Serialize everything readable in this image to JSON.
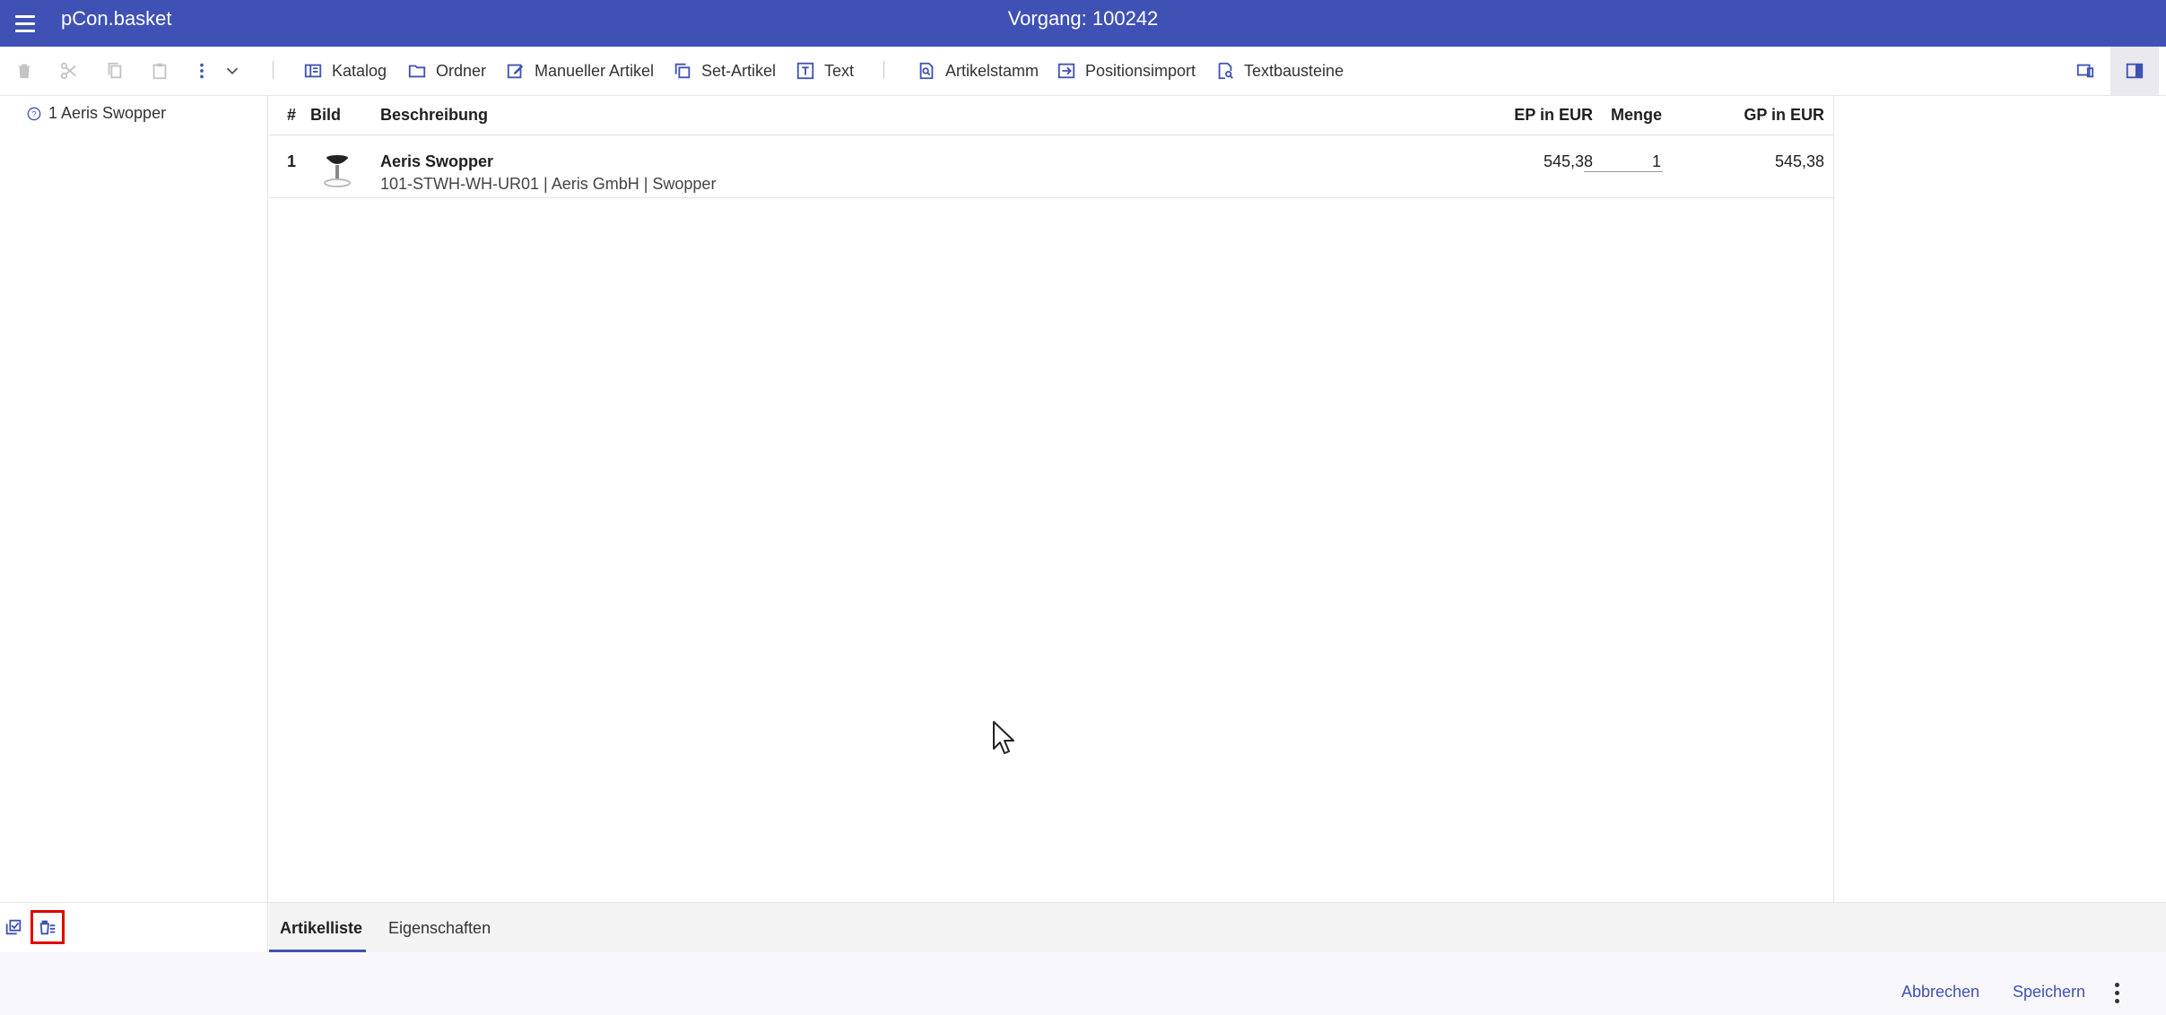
{
  "app": {
    "name": "pCon.basket",
    "title": "Vorgang: 100242"
  },
  "toolbar": {
    "katalog": "Katalog",
    "ordner": "Ordner",
    "manueller_artikel": "Manueller Artikel",
    "set_artikel": "Set-Artikel",
    "text": "Text",
    "artikelstamm": "Artikelstamm",
    "positionsimport": "Positionsimport",
    "textbausteine": "Textbausteine"
  },
  "tree": {
    "items": [
      {
        "label": "1 Aeris Swopper"
      }
    ]
  },
  "table": {
    "headers": {
      "num": "#",
      "bild": "Bild",
      "beschreibung": "Beschreibung",
      "ep": "EP in EUR",
      "menge": "Menge",
      "gp": "GP in EUR"
    },
    "rows": [
      {
        "num": "1",
        "name": "Aeris Swopper",
        "desc": "101-STWH-WH-UR01 | Aeris GmbH | Swopper",
        "ep": "545,38",
        "menge": "1",
        "gp": "545,38"
      }
    ]
  },
  "tabs": [
    {
      "label": "Artikelliste",
      "active": true
    },
    {
      "label": "Eigenschaften",
      "active": false
    }
  ],
  "footer": {
    "cancel": "Abbrechen",
    "save": "Speichern"
  },
  "colors": {
    "primary": "#3f51b5",
    "highlight": "#e00000"
  }
}
